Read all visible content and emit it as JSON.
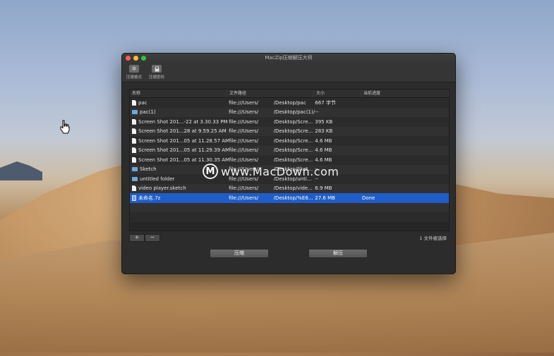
{
  "window": {
    "title": "MacZip压缩解压大师",
    "traffic_colors": [
      "#fe5f57",
      "#febc2e",
      "#28c840"
    ]
  },
  "toolbar": [
    {
      "label": "压缩格式",
      "icon": "gear-icon"
    },
    {
      "label": "压缩密码",
      "icon": "lock-icon"
    }
  ],
  "table": {
    "headers": [
      "名称",
      "文件路径",
      "",
      "大小",
      "当前进度"
    ],
    "rows": [
      {
        "name": "pac",
        "icon": "document-icon",
        "path1": "file:///Users/",
        "path2": "/Desktop/pac",
        "size": "667 字节",
        "progress": ""
      },
      {
        "name": "pac(1)",
        "icon": "folder-icon",
        "path1": "file:///Users/",
        "path2": "/Desktop/pac(1)/",
        "size": "--",
        "progress": ""
      },
      {
        "name": "Screen Shot 201...-22 at 3.30.33 PM",
        "icon": "document-icon",
        "path1": "file:///Users/",
        "path2": "/Desktop/Scre...",
        "size": "395 KB",
        "progress": ""
      },
      {
        "name": "Screen Shot 201...28 at 9.59.25 AM",
        "icon": "document-icon",
        "path1": "file:///Users/",
        "path2": "/Desktop/Scre...",
        "size": "283 KB",
        "progress": ""
      },
      {
        "name": "Screen Shot 201...05 at 11.28.57 AM",
        "icon": "document-icon",
        "path1": "file:///Users/",
        "path2": "/Desktop/Scre...",
        "size": "4.6 MB",
        "progress": ""
      },
      {
        "name": "Screen Shot 201...05 at 11.29.39 AM",
        "icon": "document-icon",
        "path1": "file:///Users/",
        "path2": "/Desktop/Scre...",
        "size": "4.6 MB",
        "progress": ""
      },
      {
        "name": "Screen Shot 201...05 at 11.30.35 AM",
        "icon": "document-icon",
        "path1": "file:///Users/",
        "path2": "/Desktop/Scre...",
        "size": "4.6 MB",
        "progress": ""
      },
      {
        "name": "Sketch",
        "icon": "folder-icon",
        "path1": "file:///Users/",
        "path2": "/Desktop/Sket...",
        "size": "--",
        "progress": ""
      },
      {
        "name": "untitled folder",
        "icon": "folder-icon",
        "path1": "file:///Users/",
        "path2": "/Desktop/unti...",
        "size": "--",
        "progress": ""
      },
      {
        "name": "video player.sketch",
        "icon": "document-icon",
        "path1": "file:///Users/",
        "path2": "/Desktop/vide...",
        "size": "6.9 MB",
        "progress": ""
      },
      {
        "name": "未命名.7z",
        "icon": "archive-icon",
        "path1": "file:///Users/",
        "path2": "/Desktop/%E6...",
        "size": "27.6 MB",
        "progress": "Done",
        "selected": true
      }
    ]
  },
  "controls": {
    "add": "+",
    "remove": "−",
    "selection_count": "1 文件被选择",
    "compress_button": "压缩",
    "extract_button": "解压"
  },
  "watermark": {
    "logo": "M",
    "text": "www.MacDown.com"
  }
}
